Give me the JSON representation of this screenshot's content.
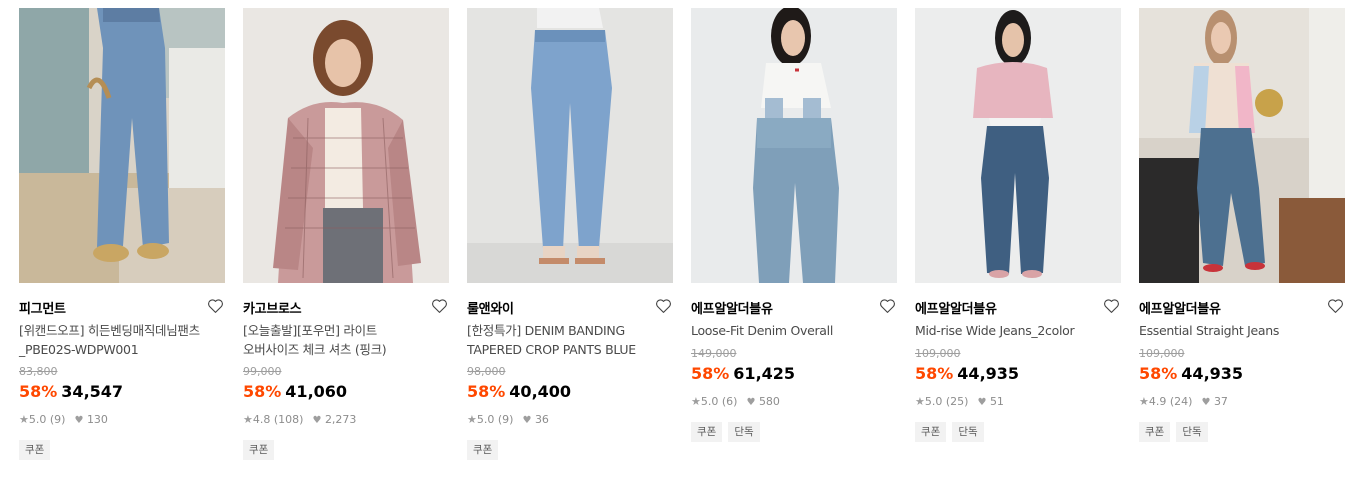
{
  "products": [
    {
      "brand": "피그먼트",
      "name_line1": "[위캔드오프] 히든벤딩매직데님팬츠",
      "name_line2": "_PBE02S-WDPW001",
      "original_price": "83,800",
      "discount": "58%",
      "price": "34,547",
      "rating": "5.0",
      "reviews": "(9)",
      "likes": "130",
      "tags": [
        "쿠폰"
      ],
      "image": "heart-like-button"
    },
    {
      "brand": "카고브로스",
      "name_line1": "[오늘출발][포우먼] 라이트",
      "name_line2": "오버사이즈 체크 셔츠 (핑크)",
      "original_price": "99,000",
      "discount": "58%",
      "price": "41,060",
      "rating": "4.8",
      "reviews": "(108)",
      "likes": "2,273",
      "tags": [
        "쿠폰"
      ]
    },
    {
      "brand": "룰앤와이",
      "name_line1": "[한정특가] DENIM BANDING",
      "name_line2": "TAPERED CROP PANTS BLUE",
      "original_price": "98,000",
      "discount": "58%",
      "price": "40,400",
      "rating": "5.0",
      "reviews": "(9)",
      "likes": "36",
      "tags": [
        "쿠폰"
      ]
    },
    {
      "brand": "에프알알더블유",
      "name_line1": "Loose-Fit Denim Overall",
      "name_line2": "",
      "original_price": "149,000",
      "discount": "58%",
      "price": "61,425",
      "rating": "5.0",
      "reviews": "(6)",
      "likes": "580",
      "tags": [
        "쿠폰",
        "단독"
      ]
    },
    {
      "brand": "에프알알더블유",
      "name_line1": "Mid-rise Wide Jeans_2color",
      "name_line2": "",
      "original_price": "109,000",
      "discount": "58%",
      "price": "44,935",
      "rating": "5.0",
      "reviews": "(25)",
      "likes": "51",
      "tags": [
        "쿠폰",
        "단독"
      ]
    },
    {
      "brand": "에프알알더블유",
      "name_line1": "Essential Straight Jeans",
      "name_line2": "",
      "original_price": "109,000",
      "discount": "58%",
      "price": "44,935",
      "rating": "4.9",
      "reviews": "(24)",
      "likes": "37",
      "tags": [
        "쿠폰",
        "단독"
      ]
    }
  ],
  "colors": {
    "discount": "#ff4800",
    "muted": "#9e9e9e",
    "tag_bg": "#f2f2f2"
  },
  "icons": {
    "like": "heart-outline-icon",
    "rating": "star-icon",
    "likes_count": "heart-filled-icon"
  }
}
